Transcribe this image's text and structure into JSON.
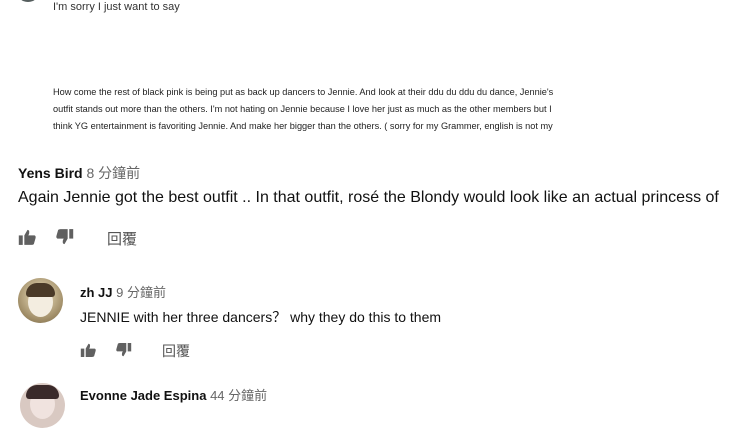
{
  "comments": [
    {
      "text": "I'm sorry I just want to say"
    },
    {
      "paragraph": [
        "How come the rest of black pink is being put as back up dancers to Jennie. And look at their ddu du ddu du dance, Jennie's",
        "outfit stands out more than the others. I'm not hating on Jennie because I love her just as much as the other members but I",
        "think YG entertainment is favoriting Jennie. And make her bigger than the others. ( sorry for my Grammer, english is not my"
      ]
    },
    {
      "author": "Yens Bird",
      "time": "8 分鐘前",
      "text": "Again Jennie got the best outfit .. In that outfit, rosé the Blondy would look like an actual princess of",
      "reply_label": "回覆"
    },
    {
      "author": "zh JJ",
      "time": "9 分鐘前",
      "text": "JENNIE with her three dancers？ why they do this to them",
      "reply_label": "回覆"
    },
    {
      "author": "Evonne Jade Espina",
      "time": "44 分鐘前"
    }
  ],
  "icons": {
    "like": "thumbs-up-icon",
    "dislike": "thumbs-down-icon"
  },
  "colors": {
    "icon": "#606060",
    "time": "#666666"
  }
}
